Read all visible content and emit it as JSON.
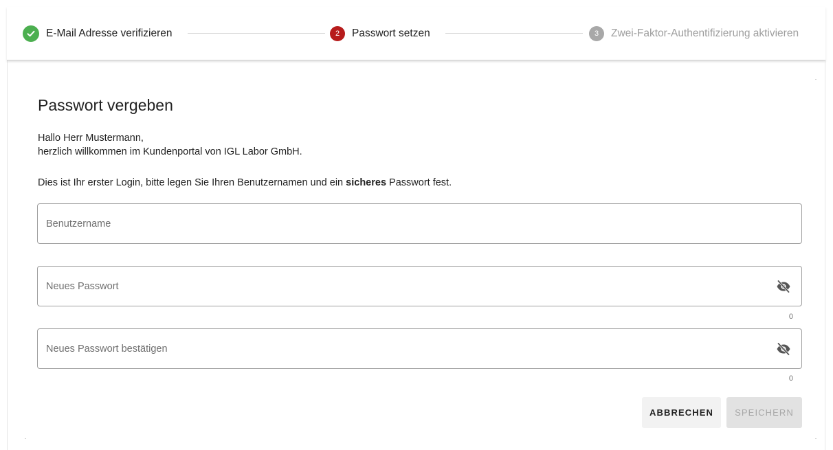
{
  "stepper": {
    "steps": [
      {
        "number": "",
        "label": "E-Mail Adresse verifizieren",
        "state": "done"
      },
      {
        "number": "2",
        "label": "Passwort setzen",
        "state": "active"
      },
      {
        "number": "3",
        "label": "Zwei-Faktor-Authentifizierung aktivieren",
        "state": "pending"
      }
    ]
  },
  "page": {
    "title": "Passwort vergeben",
    "greeting_line1": "Hallo Herr Mustermann,",
    "greeting_line2": "herzlich willkommen im Kundenportal von IGL Labor GmbH.",
    "intro_before": "Dies ist Ihr erster Login, bitte legen Sie Ihren Benutzernamen und ein ",
    "intro_bold": "sicheres",
    "intro_after": " Passwort fest."
  },
  "form": {
    "username_placeholder": "Benutzername",
    "username_value": "",
    "password_placeholder": "Neues Passwort",
    "password_value": "",
    "password_counter": "0",
    "confirm_placeholder": "Neues Passwort bestätigen",
    "confirm_value": "",
    "confirm_counter": "0"
  },
  "buttons": {
    "cancel_label": "ABBRECHEN",
    "save_label": "SPEICHERN"
  },
  "icons": {
    "done": "check-icon",
    "visibility": "eye-off-icon"
  },
  "colors": {
    "success": "#4caf50",
    "accent": "#b71c1c",
    "pending": "#a8a8a8"
  }
}
